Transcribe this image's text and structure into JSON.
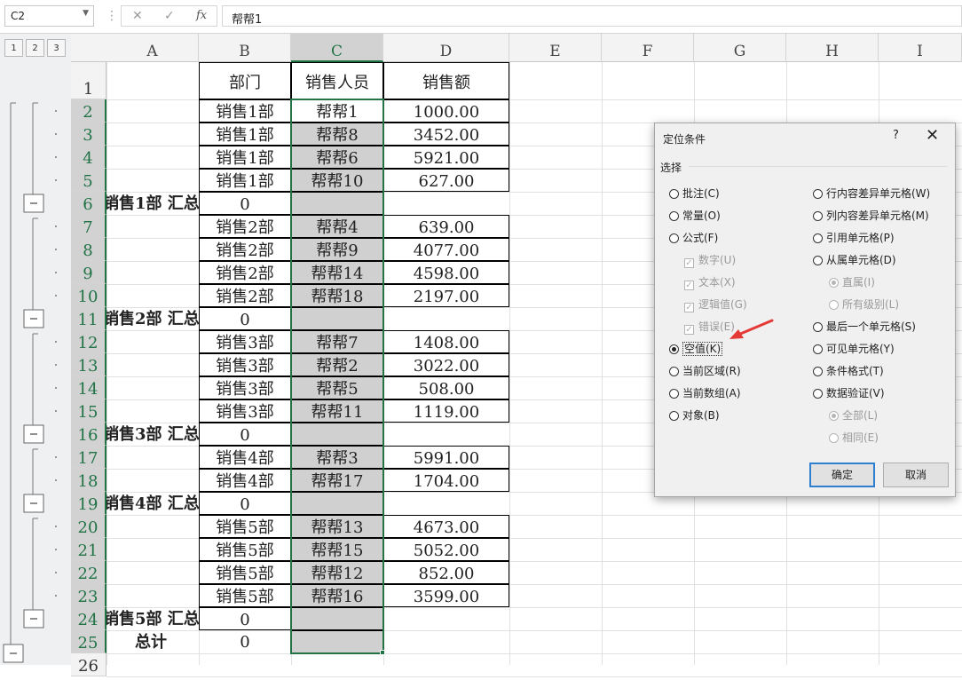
{
  "formula_bar": {
    "name_box": "C2",
    "cancel_glyph": "✕",
    "enter_glyph": "✓",
    "fx_label": "fx",
    "formula": "帮帮1"
  },
  "outline_levels": [
    "1",
    "2",
    "3"
  ],
  "columns": [
    "A",
    "B",
    "C",
    "D",
    "E",
    "F",
    "G",
    "H",
    "I"
  ],
  "selected_column": "C",
  "rows": [
    {
      "num": "1",
      "a": "",
      "b": "部门",
      "c": "销售人员",
      "d": "销售额"
    },
    {
      "num": "2",
      "a": "",
      "b": "销售1部",
      "c": "帮帮1",
      "d": "1000.00"
    },
    {
      "num": "3",
      "a": "",
      "b": "销售1部",
      "c": "帮帮8",
      "d": "3452.00"
    },
    {
      "num": "4",
      "a": "",
      "b": "销售1部",
      "c": "帮帮6",
      "d": "5921.00"
    },
    {
      "num": "5",
      "a": "",
      "b": "销售1部",
      "c": "帮帮10",
      "d": "627.00"
    },
    {
      "num": "6",
      "a": "销售1部 汇总",
      "b": "0",
      "c": "",
      "d": ""
    },
    {
      "num": "7",
      "a": "",
      "b": "销售2部",
      "c": "帮帮4",
      "d": "639.00"
    },
    {
      "num": "8",
      "a": "",
      "b": "销售2部",
      "c": "帮帮9",
      "d": "4077.00"
    },
    {
      "num": "9",
      "a": "",
      "b": "销售2部",
      "c": "帮帮14",
      "d": "4598.00"
    },
    {
      "num": "10",
      "a": "",
      "b": "销售2部",
      "c": "帮帮18",
      "d": "2197.00"
    },
    {
      "num": "11",
      "a": "销售2部 汇总",
      "b": "0",
      "c": "",
      "d": ""
    },
    {
      "num": "12",
      "a": "",
      "b": "销售3部",
      "c": "帮帮7",
      "d": "1408.00"
    },
    {
      "num": "13",
      "a": "",
      "b": "销售3部",
      "c": "帮帮2",
      "d": "3022.00"
    },
    {
      "num": "14",
      "a": "",
      "b": "销售3部",
      "c": "帮帮5",
      "d": "508.00"
    },
    {
      "num": "15",
      "a": "",
      "b": "销售3部",
      "c": "帮帮11",
      "d": "1119.00"
    },
    {
      "num": "16",
      "a": "销售3部 汇总",
      "b": "0",
      "c": "",
      "d": ""
    },
    {
      "num": "17",
      "a": "",
      "b": "销售4部",
      "c": "帮帮3",
      "d": "5991.00"
    },
    {
      "num": "18",
      "a": "",
      "b": "销售4部",
      "c": "帮帮17",
      "d": "1704.00"
    },
    {
      "num": "19",
      "a": "销售4部 汇总",
      "b": "0",
      "c": "",
      "d": ""
    },
    {
      "num": "20",
      "a": "",
      "b": "销售5部",
      "c": "帮帮13",
      "d": "4673.00"
    },
    {
      "num": "21",
      "a": "",
      "b": "销售5部",
      "c": "帮帮15",
      "d": "5052.00"
    },
    {
      "num": "22",
      "a": "",
      "b": "销售5部",
      "c": "帮帮12",
      "d": "852.00"
    },
    {
      "num": "23",
      "a": "",
      "b": "销售5部",
      "c": "帮帮16",
      "d": "3599.00"
    },
    {
      "num": "24",
      "a": "销售5部 汇总",
      "b": "0",
      "c": "",
      "d": ""
    },
    {
      "num": "25",
      "a": "总计",
      "b": "0",
      "c": "",
      "d": ""
    },
    {
      "num": "26",
      "a": "",
      "b": "",
      "c": "",
      "d": ""
    }
  ],
  "dialog": {
    "title": "定位条件",
    "help": "?",
    "close": "✕",
    "group_label": "选择",
    "left_options": [
      {
        "label": "批注(C)",
        "checked": false,
        "type": "radio",
        "disabled": false
      },
      {
        "label": "常量(O)",
        "checked": false,
        "type": "radio",
        "disabled": false
      },
      {
        "label": "公式(F)",
        "checked": false,
        "type": "radio",
        "disabled": false
      },
      {
        "label": "数字(U)",
        "checked": true,
        "type": "checkbox",
        "disabled": true
      },
      {
        "label": "文本(X)",
        "checked": true,
        "type": "checkbox",
        "disabled": true
      },
      {
        "label": "逻辑值(G)",
        "checked": true,
        "type": "checkbox",
        "disabled": true
      },
      {
        "label": "错误(E)",
        "checked": true,
        "type": "checkbox",
        "disabled": true
      },
      {
        "label": "空值(K)",
        "checked": true,
        "type": "radio",
        "disabled": false
      },
      {
        "label": "当前区域(R)",
        "checked": false,
        "type": "radio",
        "disabled": false
      },
      {
        "label": "当前数组(A)",
        "checked": false,
        "type": "radio",
        "disabled": false
      },
      {
        "label": "对象(B)",
        "checked": false,
        "type": "radio",
        "disabled": false
      }
    ],
    "right_options": [
      {
        "label": "行内容差异单元格(W)",
        "checked": false,
        "disabled": false
      },
      {
        "label": "列内容差异单元格(M)",
        "checked": false,
        "disabled": false
      },
      {
        "label": "引用单元格(P)",
        "checked": false,
        "disabled": false
      },
      {
        "label": "从属单元格(D)",
        "checked": false,
        "disabled": false
      },
      {
        "label": "直属(I)",
        "checked": true,
        "disabled": true
      },
      {
        "label": "所有级别(L)",
        "checked": false,
        "disabled": true
      },
      {
        "label": "最后一个单元格(S)",
        "checked": false,
        "disabled": false
      },
      {
        "label": "可见单元格(Y)",
        "checked": false,
        "disabled": false
      },
      {
        "label": "条件格式(T)",
        "checked": false,
        "disabled": false
      },
      {
        "label": "数据验证(V)",
        "checked": false,
        "disabled": false
      },
      {
        "label": "全部(L)",
        "checked": true,
        "disabled": true
      },
      {
        "label": "相同(E)",
        "checked": false,
        "disabled": true
      }
    ],
    "ok_label": "确定",
    "cancel_label": "取消"
  },
  "colors": {
    "selection_green": "#217346",
    "annotation_arrow": "#e53935",
    "default_button_border": "#2f7fd1"
  }
}
